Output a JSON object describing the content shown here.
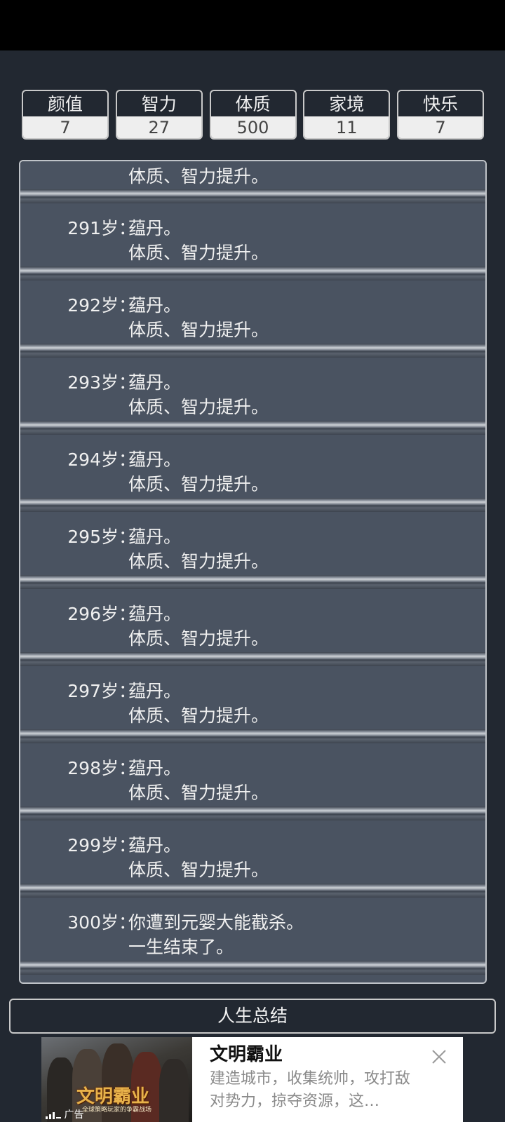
{
  "stats": [
    {
      "label": "颜值",
      "value": "7"
    },
    {
      "label": "智力",
      "value": "27"
    },
    {
      "label": "体质",
      "value": "500"
    },
    {
      "label": "家境",
      "value": "11"
    },
    {
      "label": "快乐",
      "value": "7"
    }
  ],
  "log": {
    "partial_line": "体质、智力提升。",
    "entries": [
      {
        "age": "291岁：",
        "line1": "蕴丹。",
        "line2": "体质、智力提升。"
      },
      {
        "age": "292岁：",
        "line1": "蕴丹。",
        "line2": "体质、智力提升。"
      },
      {
        "age": "293岁：",
        "line1": "蕴丹。",
        "line2": "体质、智力提升。"
      },
      {
        "age": "294岁：",
        "line1": "蕴丹。",
        "line2": "体质、智力提升。"
      },
      {
        "age": "295岁：",
        "line1": "蕴丹。",
        "line2": "体质、智力提升。"
      },
      {
        "age": "296岁：",
        "line1": "蕴丹。",
        "line2": "体质、智力提升。"
      },
      {
        "age": "297岁：",
        "line1": "蕴丹。",
        "line2": "体质、智力提升。"
      },
      {
        "age": "298岁：",
        "line1": "蕴丹。",
        "line2": "体质、智力提升。"
      },
      {
        "age": "299岁：",
        "line1": "蕴丹。",
        "line2": "体质、智力提升。"
      },
      {
        "age": "300岁：",
        "line1": "你遭到元婴大能截杀。",
        "line2": "一生结束了。"
      }
    ]
  },
  "summary_button": "人生总结",
  "ad": {
    "title": "文明霸业",
    "description": "建造城市，收集统帅，攻打敌对势力，掠夺资源，这…",
    "image_logo": "文明霸业",
    "image_tagline": "全球策略玩家的争霸战场",
    "ad_mark": "广告",
    "close_icon": "close-icon"
  }
}
